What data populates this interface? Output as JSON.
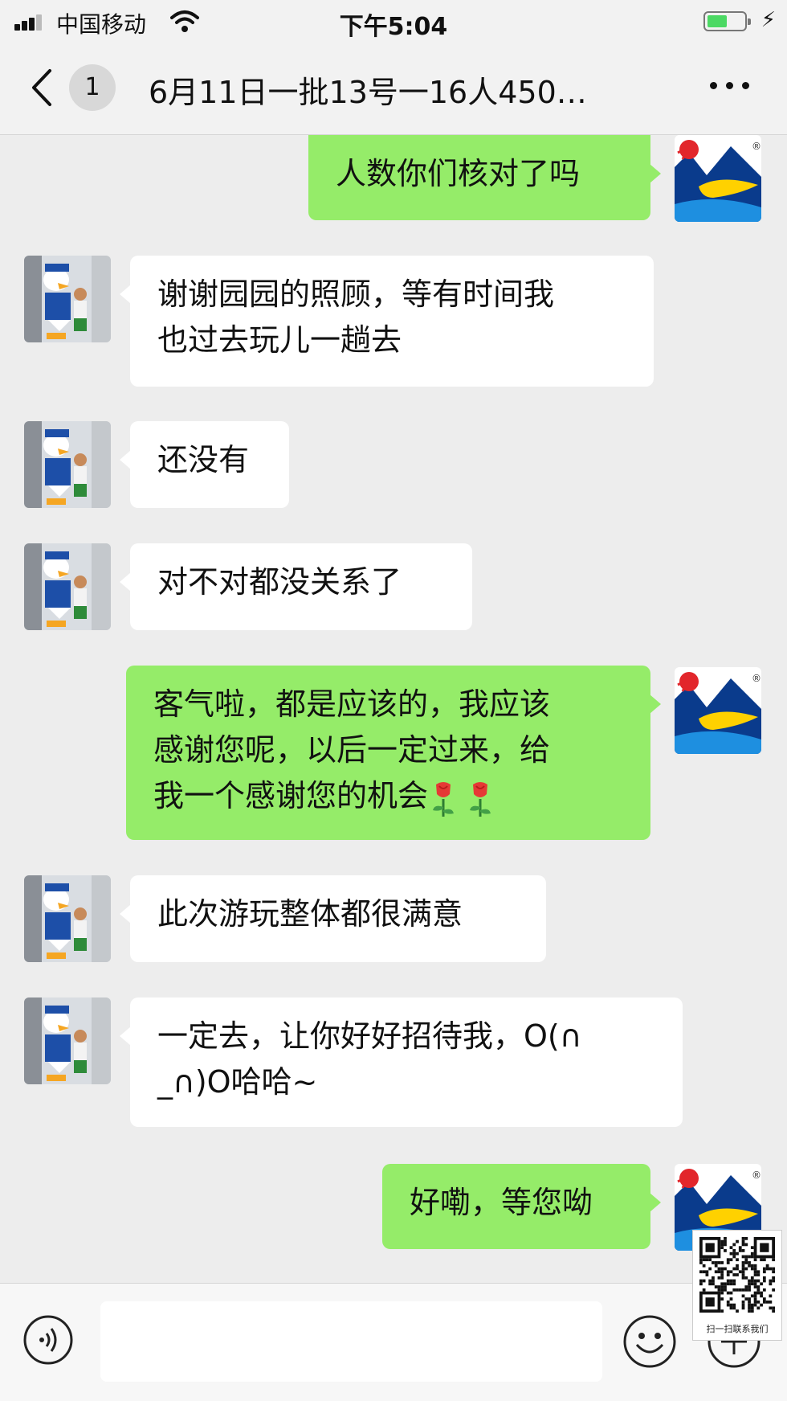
{
  "status_bar": {
    "carrier": "中国移动",
    "time": "下午5:04",
    "battery_fraction": 0.55
  },
  "nav": {
    "back_badge": "1",
    "title": "6月11日一批13号一16人450…"
  },
  "messages": [
    {
      "side": "out",
      "text": "人数你们核对了吗"
    },
    {
      "side": "in",
      "lines": [
        "谢谢园园的照顾，等有时间我",
        "也过去玩儿一趟去"
      ]
    },
    {
      "side": "in",
      "text": "还没有"
    },
    {
      "side": "in",
      "text": "对不对都没关系了"
    },
    {
      "side": "out",
      "lines": [
        "客气啦，都是应该的，我应该",
        "感谢您呢，以后一定过来，给",
        "我一个感谢您的机会"
      ],
      "trailing_emoji": [
        "rose-emoji",
        "rose-emoji"
      ]
    },
    {
      "side": "in",
      "text": "此次游玩整体都很满意"
    },
    {
      "side": "in",
      "lines": [
        "一定去，让你好好招待我，O(∩",
        "_∩)O哈哈~"
      ]
    },
    {
      "side": "out",
      "text": "好嘞，等您呦"
    }
  ],
  "qr_overlay": {
    "caption": "扫一扫联系我们"
  },
  "colors": {
    "outgoing_bubble": "#95ec69",
    "incoming_bubble": "#ffffff",
    "background": "#ededed"
  },
  "icons": {
    "back": "chevron-left-icon",
    "more": "more-dots-icon",
    "voice": "voice-icon",
    "emoji": "emoji-icon",
    "plus": "plus-icon"
  }
}
